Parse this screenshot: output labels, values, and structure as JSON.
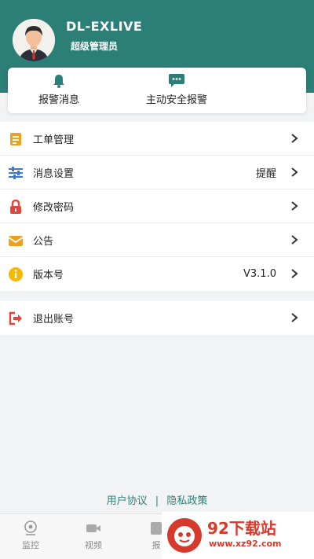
{
  "user": {
    "name": "DL-EXLIVE",
    "role": "超级管理员"
  },
  "quick_actions": [
    {
      "label": "报警消息",
      "icon": "bell-icon"
    },
    {
      "label": "主动安全报警",
      "icon": "chat-icon"
    }
  ],
  "menu": [
    {
      "label": "工单管理",
      "value": "",
      "icon": "document-icon",
      "color": "#f0a020"
    },
    {
      "label": "消息设置",
      "value": "提醒",
      "icon": "sliders-icon",
      "color": "#3a7bd5"
    },
    {
      "label": "修改密码",
      "value": "",
      "icon": "lock-icon",
      "color": "#e2463b"
    },
    {
      "label": "公告",
      "value": "",
      "icon": "mail-icon",
      "color": "#f0a020"
    },
    {
      "label": "版本号",
      "value": "V3.1.0",
      "icon": "info-icon",
      "color": "#f5b800"
    }
  ],
  "logout": {
    "label": "退出账号",
    "icon": "logout-icon",
    "color": "#e2463b"
  },
  "footer": {
    "agreement": "用户协议",
    "separator": "|",
    "privacy": "隐私政策"
  },
  "tabs": [
    {
      "label": "监控",
      "icon": "monitor-icon"
    },
    {
      "label": "视频",
      "icon": "video-icon"
    },
    {
      "label": "报",
      "icon": "report-icon"
    }
  ],
  "watermark": {
    "text": "92下载站",
    "url": "www.xz92.com"
  },
  "colors": {
    "primary": "#2c7f76",
    "background": "#f2f3f5"
  }
}
